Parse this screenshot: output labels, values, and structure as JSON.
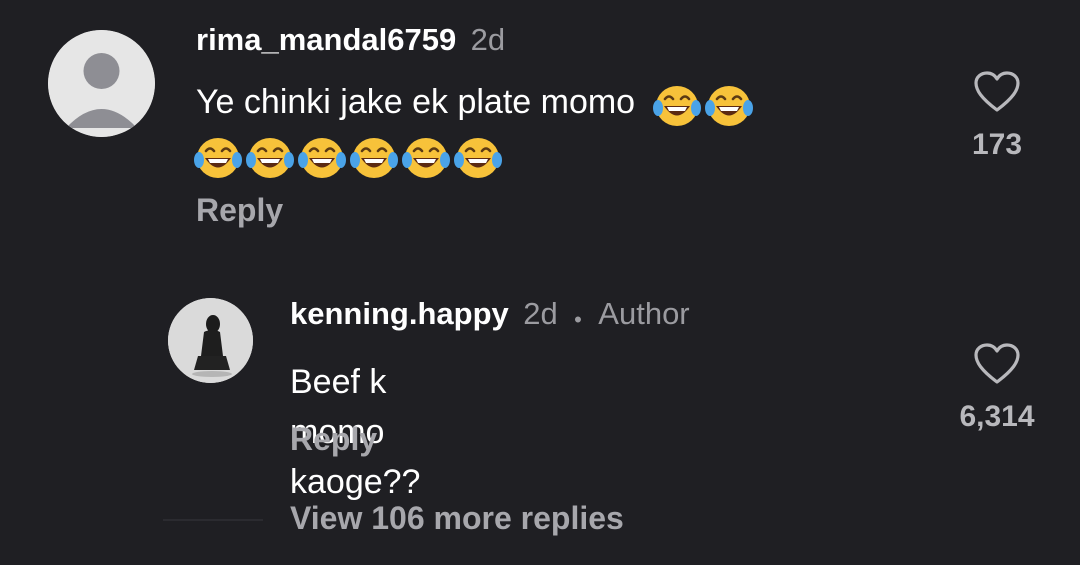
{
  "comments": [
    {
      "username": "rima_mandal6759",
      "time": "2d",
      "text": "Ye chinki jake ek plate momo",
      "emoji_name": "face-with-tears-of-joy",
      "like_count": "173",
      "reply_label": "Reply"
    },
    {
      "username": "kenning.happy",
      "time": "2d",
      "author_badge": "Author",
      "text": "Beef k momo kaoge??",
      "like_count": "6,314",
      "reply_label": "Reply"
    }
  ],
  "view_more_label": "View 106 more replies",
  "colors": {
    "background": "#1f1f23",
    "text": "#ffffff",
    "meta": "#9b9ba0",
    "action": "#a7a7ac"
  }
}
